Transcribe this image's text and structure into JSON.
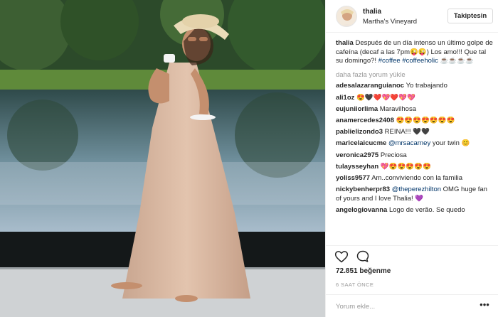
{
  "post": {
    "author": "thalia",
    "location": "Martha's Vineyard",
    "follow_label": "Takiptesin",
    "caption_text": "Después de un día intenso un último golpe de cafeína (decaf a las 7pm😜😜) Los amo!!! Que tal su domingo?! ",
    "caption_tags": [
      "#coffee",
      "#coffeeholic"
    ],
    "caption_emoji": "☕☕☕☕",
    "load_more": "daha fazla yorum yükle",
    "likes": "72.851 beğenme",
    "time": "6 SAAT ÖNCE",
    "comment_placeholder": "Yorum ekle...",
    "more_icon": "•••"
  },
  "comments": [
    {
      "user": "adesalazaranguianoc",
      "text": "Yo trabajando"
    },
    {
      "user": "ali1oz",
      "text": "😍🖤❤️💖❤️💖💖"
    },
    {
      "user": "eujuniiorlima",
      "text": "Maravilhosa"
    },
    {
      "user": "anamercedes2408",
      "text": "😍😍😍😍😍😍😍"
    },
    {
      "user": "pablielizondo3",
      "text": "REINA!!! 🖤🖤"
    },
    {
      "user": "maricelaicucme",
      "mention": "@mrsacarney",
      "text": "your twin 😊"
    },
    {
      "user": "veronica2975",
      "text": "Preciosa"
    },
    {
      "user": "tulaysseyhan",
      "text": "💖😍😍😍😍😍"
    },
    {
      "user": "yoliss9577",
      "text": "Am..conviviendo con la familia"
    },
    {
      "user": "nickybenherpr83",
      "mention": "@theperezhilton",
      "text": "OMG huge fan of yours and I love Thalia! 💜"
    },
    {
      "user": "angelogiovanna",
      "text": "Logo de verão. Se quedo"
    }
  ],
  "icons": {
    "like": "heart-icon",
    "comment": "comment-bubble-icon",
    "more": "more-options-icon"
  },
  "colors": {
    "link": "#003569",
    "muted": "#999999",
    "border": "#efefef",
    "text": "#262626"
  }
}
